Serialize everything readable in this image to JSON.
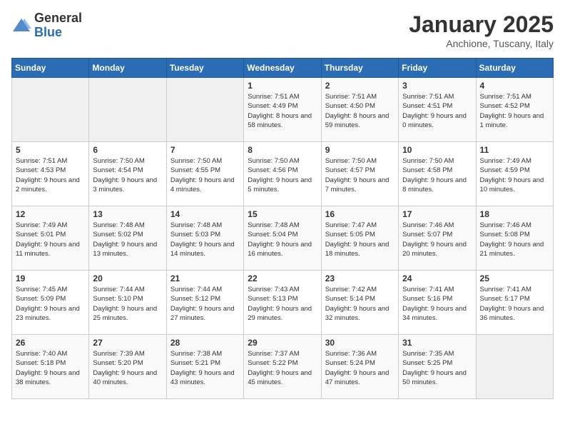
{
  "logo": {
    "general": "General",
    "blue": "Blue"
  },
  "title": {
    "month": "January 2025",
    "location": "Anchione, Tuscany, Italy"
  },
  "days_of_week": [
    "Sunday",
    "Monday",
    "Tuesday",
    "Wednesday",
    "Thursday",
    "Friday",
    "Saturday"
  ],
  "weeks": [
    [
      {
        "day": "",
        "empty": true
      },
      {
        "day": "",
        "empty": true
      },
      {
        "day": "",
        "empty": true
      },
      {
        "day": "1",
        "sunrise": "7:51 AM",
        "sunset": "4:49 PM",
        "daylight": "8 hours and 58 minutes."
      },
      {
        "day": "2",
        "sunrise": "7:51 AM",
        "sunset": "4:50 PM",
        "daylight": "8 hours and 59 minutes."
      },
      {
        "day": "3",
        "sunrise": "7:51 AM",
        "sunset": "4:51 PM",
        "daylight": "9 hours and 0 minutes."
      },
      {
        "day": "4",
        "sunrise": "7:51 AM",
        "sunset": "4:52 PM",
        "daylight": "9 hours and 1 minute."
      }
    ],
    [
      {
        "day": "5",
        "sunrise": "7:51 AM",
        "sunset": "4:53 PM",
        "daylight": "9 hours and 2 minutes."
      },
      {
        "day": "6",
        "sunrise": "7:50 AM",
        "sunset": "4:54 PM",
        "daylight": "9 hours and 3 minutes."
      },
      {
        "day": "7",
        "sunrise": "7:50 AM",
        "sunset": "4:55 PM",
        "daylight": "9 hours and 4 minutes."
      },
      {
        "day": "8",
        "sunrise": "7:50 AM",
        "sunset": "4:56 PM",
        "daylight": "9 hours and 5 minutes."
      },
      {
        "day": "9",
        "sunrise": "7:50 AM",
        "sunset": "4:57 PM",
        "daylight": "9 hours and 7 minutes."
      },
      {
        "day": "10",
        "sunrise": "7:50 AM",
        "sunset": "4:58 PM",
        "daylight": "9 hours and 8 minutes."
      },
      {
        "day": "11",
        "sunrise": "7:49 AM",
        "sunset": "4:59 PM",
        "daylight": "9 hours and 10 minutes."
      }
    ],
    [
      {
        "day": "12",
        "sunrise": "7:49 AM",
        "sunset": "5:01 PM",
        "daylight": "9 hours and 11 minutes."
      },
      {
        "day": "13",
        "sunrise": "7:48 AM",
        "sunset": "5:02 PM",
        "daylight": "9 hours and 13 minutes."
      },
      {
        "day": "14",
        "sunrise": "7:48 AM",
        "sunset": "5:03 PM",
        "daylight": "9 hours and 14 minutes."
      },
      {
        "day": "15",
        "sunrise": "7:48 AM",
        "sunset": "5:04 PM",
        "daylight": "9 hours and 16 minutes."
      },
      {
        "day": "16",
        "sunrise": "7:47 AM",
        "sunset": "5:05 PM",
        "daylight": "9 hours and 18 minutes."
      },
      {
        "day": "17",
        "sunrise": "7:46 AM",
        "sunset": "5:07 PM",
        "daylight": "9 hours and 20 minutes."
      },
      {
        "day": "18",
        "sunrise": "7:46 AM",
        "sunset": "5:08 PM",
        "daylight": "9 hours and 21 minutes."
      }
    ],
    [
      {
        "day": "19",
        "sunrise": "7:45 AM",
        "sunset": "5:09 PM",
        "daylight": "9 hours and 23 minutes."
      },
      {
        "day": "20",
        "sunrise": "7:44 AM",
        "sunset": "5:10 PM",
        "daylight": "9 hours and 25 minutes."
      },
      {
        "day": "21",
        "sunrise": "7:44 AM",
        "sunset": "5:12 PM",
        "daylight": "9 hours and 27 minutes."
      },
      {
        "day": "22",
        "sunrise": "7:43 AM",
        "sunset": "5:13 PM",
        "daylight": "9 hours and 29 minutes."
      },
      {
        "day": "23",
        "sunrise": "7:42 AM",
        "sunset": "5:14 PM",
        "daylight": "9 hours and 32 minutes."
      },
      {
        "day": "24",
        "sunrise": "7:41 AM",
        "sunset": "5:16 PM",
        "daylight": "9 hours and 34 minutes."
      },
      {
        "day": "25",
        "sunrise": "7:41 AM",
        "sunset": "5:17 PM",
        "daylight": "9 hours and 36 minutes."
      }
    ],
    [
      {
        "day": "26",
        "sunrise": "7:40 AM",
        "sunset": "5:18 PM",
        "daylight": "9 hours and 38 minutes."
      },
      {
        "day": "27",
        "sunrise": "7:39 AM",
        "sunset": "5:20 PM",
        "daylight": "9 hours and 40 minutes."
      },
      {
        "day": "28",
        "sunrise": "7:38 AM",
        "sunset": "5:21 PM",
        "daylight": "9 hours and 43 minutes."
      },
      {
        "day": "29",
        "sunrise": "7:37 AM",
        "sunset": "5:22 PM",
        "daylight": "9 hours and 45 minutes."
      },
      {
        "day": "30",
        "sunrise": "7:36 AM",
        "sunset": "5:24 PM",
        "daylight": "9 hours and 47 minutes."
      },
      {
        "day": "31",
        "sunrise": "7:35 AM",
        "sunset": "5:25 PM",
        "daylight": "9 hours and 50 minutes."
      },
      {
        "day": "",
        "empty": true
      }
    ]
  ]
}
